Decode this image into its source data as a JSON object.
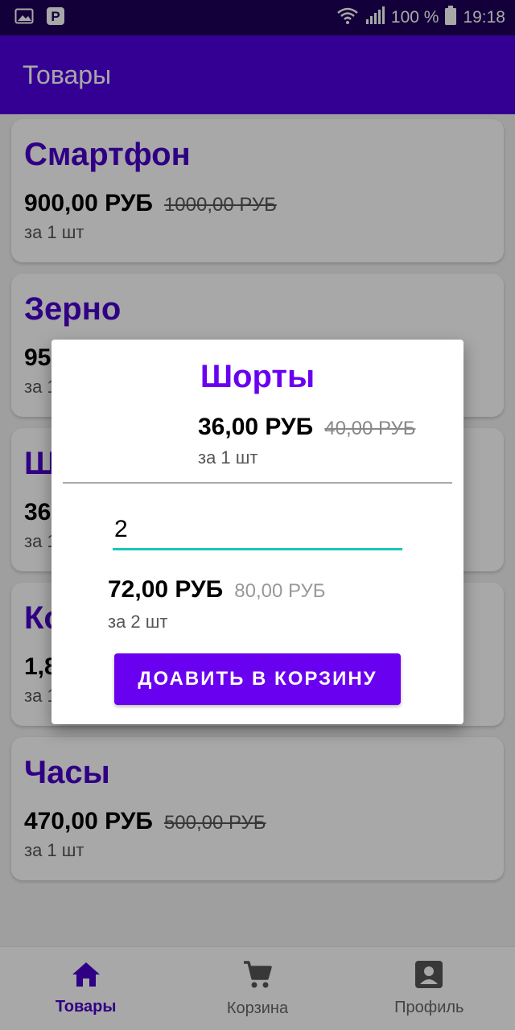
{
  "status_bar": {
    "battery": "100 %",
    "time": "19:18",
    "icons": [
      "gallery-icon",
      "parking-icon",
      "wifi-icon",
      "signal-icon",
      "battery-icon"
    ]
  },
  "app_bar": {
    "title": "Товары"
  },
  "products": [
    {
      "name": "Смартфон",
      "price": "900,00 РУБ",
      "old_price": "1000,00 РУБ",
      "qty": "за 1 шт"
    },
    {
      "name": "Зерно",
      "price": "95",
      "old_price": "",
      "qty": "за 1"
    },
    {
      "name": "Ш",
      "price": "36",
      "old_price": "",
      "qty": "за 1"
    },
    {
      "name": "Ко",
      "price": "1,8",
      "old_price": "",
      "qty": "за 1"
    },
    {
      "name": "Часы",
      "price": "470,00 РУБ",
      "old_price": "500,00 РУБ",
      "qty": "за 1 шт"
    }
  ],
  "dialog": {
    "title": "Шорты",
    "price": "36,00 РУБ",
    "old_price": "40,00 РУБ",
    "unit_qty": "за 1 шт",
    "quantity_value": "2",
    "total_price": "72,00 РУБ",
    "total_old_price": "80,00 РУБ",
    "total_qty": "за 2 шт",
    "add_button": "ДОАВИТЬ В КОРЗИНУ"
  },
  "bottom_nav": {
    "items": [
      {
        "label": "Товары",
        "icon": "home-icon",
        "active": true
      },
      {
        "label": "Корзина",
        "icon": "cart-icon",
        "active": false
      },
      {
        "label": "Профиль",
        "icon": "profile-icon",
        "active": false
      }
    ]
  },
  "colors": {
    "status_bar": "#1d0058",
    "primary": "#5000e0",
    "accent_button": "#6a00f0",
    "input_underline": "#19c6b5"
  }
}
